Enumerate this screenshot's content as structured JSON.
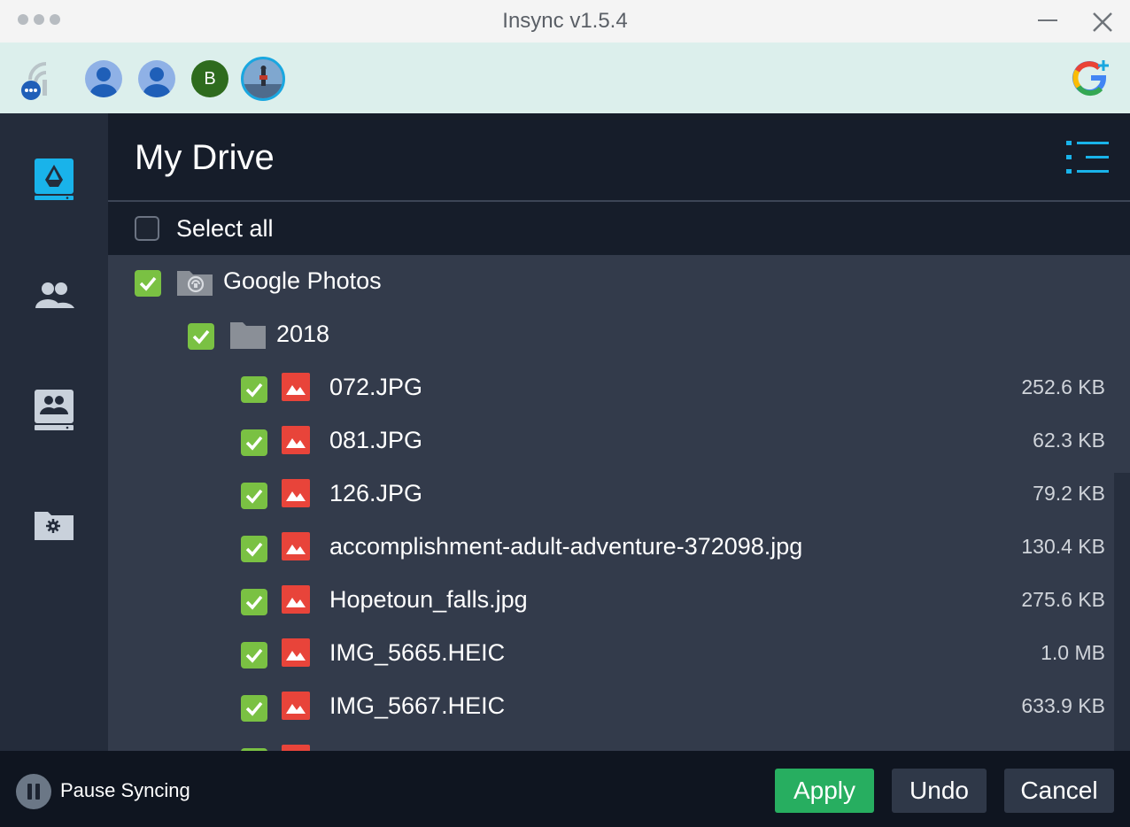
{
  "window": {
    "title": "Insync v1.5.4"
  },
  "accounts": {
    "letter_avatar": "B"
  },
  "main": {
    "title": "My Drive",
    "select_all_label": "Select all",
    "folder": {
      "name": "Google Photos",
      "checked": true
    },
    "subfolder": {
      "name": "2018",
      "checked": true
    },
    "files": [
      {
        "name": "072.JPG",
        "size": "252.6 KB",
        "checked": true
      },
      {
        "name": "081.JPG",
        "size": "62.3 KB",
        "checked": true
      },
      {
        "name": "126.JPG",
        "size": "79.2 KB",
        "checked": true
      },
      {
        "name": "accomplishment-adult-adventure-372098.jpg",
        "size": "130.4 KB",
        "checked": true
      },
      {
        "name": "Hopetoun_falls.jpg",
        "size": "275.6 KB",
        "checked": true
      },
      {
        "name": "IMG_5665.HEIC",
        "size": "1.0 MB",
        "checked": true
      },
      {
        "name": "IMG_5667.HEIC",
        "size": "633.9 KB",
        "checked": true
      }
    ]
  },
  "footer": {
    "pause_label": "Pause Syncing",
    "apply_label": "Apply",
    "undo_label": "Undo",
    "cancel_label": "Cancel"
  },
  "colors": {
    "accent": "#19a7e0",
    "check": "#7ac143",
    "apply": "#27ae60",
    "file_icon": "#e8443a"
  }
}
